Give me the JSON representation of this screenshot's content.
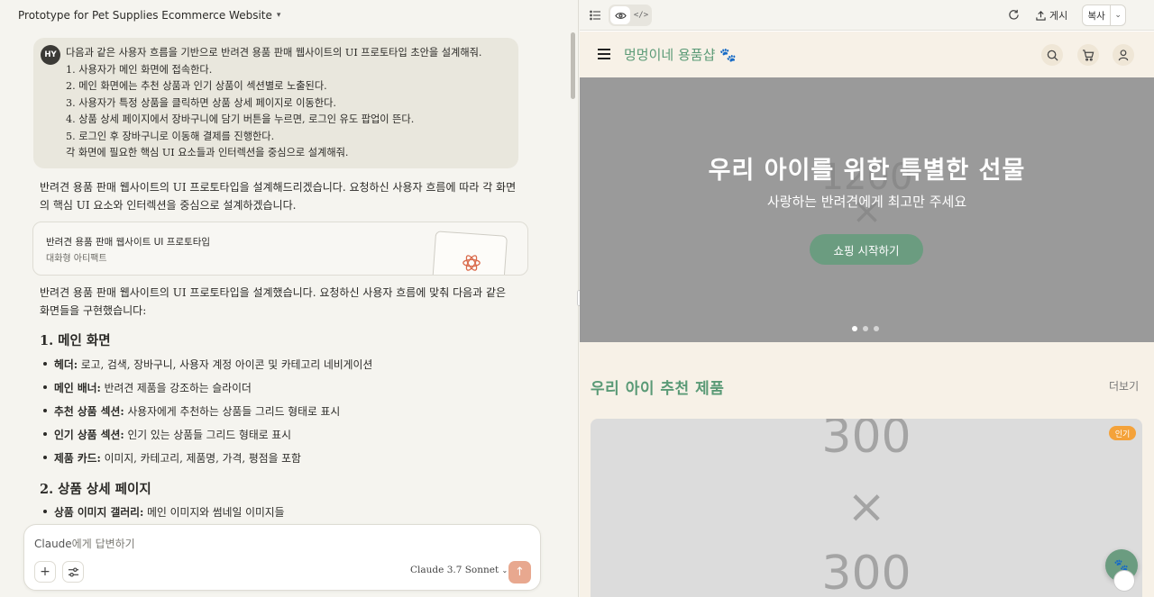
{
  "conversation": {
    "title": "Prototype for Pet Supplies Ecommerce Website",
    "user_initials": "HY",
    "user_prompt_lines": [
      "다음과 같은 사용자 흐름을 기반으로 반려견 용품 판매 웹사이트의 UI 프로토타입 초안을 설계해줘.",
      "1. 사용자가 메인 화면에 접속한다.",
      "2. 메인 화면에는 추천 상품과 인기 상품이 섹션별로 노출된다.",
      "3. 사용자가 특정 상품을 클릭하면 상품 상세 페이지로 이동한다.",
      "4. 상품 상세 페이지에서 장바구니에 담기 버튼을 누르면, 로그인 유도 팝업이 뜬다.",
      "5. 로그인 후 장바구니로 이동해 결제를 진행한다.",
      "각 화면에 필요한 핵심 UI 요소들과 인터렉션을 중심으로 설계해줘."
    ],
    "reply_intro": "반려견 용품 판매 웹사이트의 UI 프로토타입을 설계해드리겠습니다. 요청하신 사용자 흐름에 따라 각 화면의 핵심 UI 요소와 인터렉션을 중심으로 설계하겠습니다.",
    "artifact": {
      "title": "반려견 용품 판매 웹사이트 UI 프로토타입",
      "subtitle": "대화형 아티팩트"
    },
    "reply_summary": "반려견 용품 판매 웹사이트의 UI 프로토타입을 설계했습니다. 요청하신 사용자 흐름에 맞춰 다음과 같은 화면들을 구현했습니다:",
    "section1_title": "1. 메인 화면",
    "section1_bullets": [
      {
        "term": "헤더:",
        "desc": " 로고, 검색, 장바구니, 사용자 계정 아이콘 및 카테고리 네비게이션"
      },
      {
        "term": "메인 배너:",
        "desc": " 반려견 제품을 강조하는 슬라이더"
      },
      {
        "term": "추천 상품 섹션:",
        "desc": " 사용자에게 추천하는 상품들 그리드 형태로 표시"
      },
      {
        "term": "인기 상품 섹션:",
        "desc": " 인기 있는 상품들 그리드 형태로 표시"
      },
      {
        "term": "제품 카드:",
        "desc": " 이미지, 카테고리, 제품명, 가격, 평점을 포함"
      }
    ],
    "section2_title": "2. 상품 상세 페이지",
    "section2_bullets": [
      {
        "term": "상품 이미지 갤러리:",
        "desc": " 메인 이미지와 썸네일 이미지들"
      }
    ],
    "input": {
      "placeholder_latin": "Claude",
      "placeholder_rest": "에게 답변하기",
      "model_label": "Claude 3.7 Sonnet"
    }
  },
  "preview": {
    "toolbar": {
      "publish_label": "게시",
      "copy_label": "복사"
    },
    "site": {
      "brand": "멍멍이네 용품샵 🐾",
      "hero_placeholder_top": "1200",
      "hero_placeholder_mid": "×",
      "hero_title": "우리 아이를 위한 특별한 선물",
      "hero_subtitle": "사랑하는 반려견에게 최고만 주세요",
      "hero_button": "쇼핑 시작하기",
      "slides": 3,
      "active_slide": 0,
      "recommend_title": "우리 아이 추천 제품",
      "more_label": "더보기",
      "card_placeholder_top": "300",
      "card_placeholder_mid": "×",
      "card_placeholder_bottom": "300",
      "badge": "인기"
    }
  },
  "colors": {
    "accent_green": "#5a9a76",
    "button_green": "#6b9c80",
    "badge_orange": "#f4a23a",
    "send_button": "#e8a88f"
  }
}
